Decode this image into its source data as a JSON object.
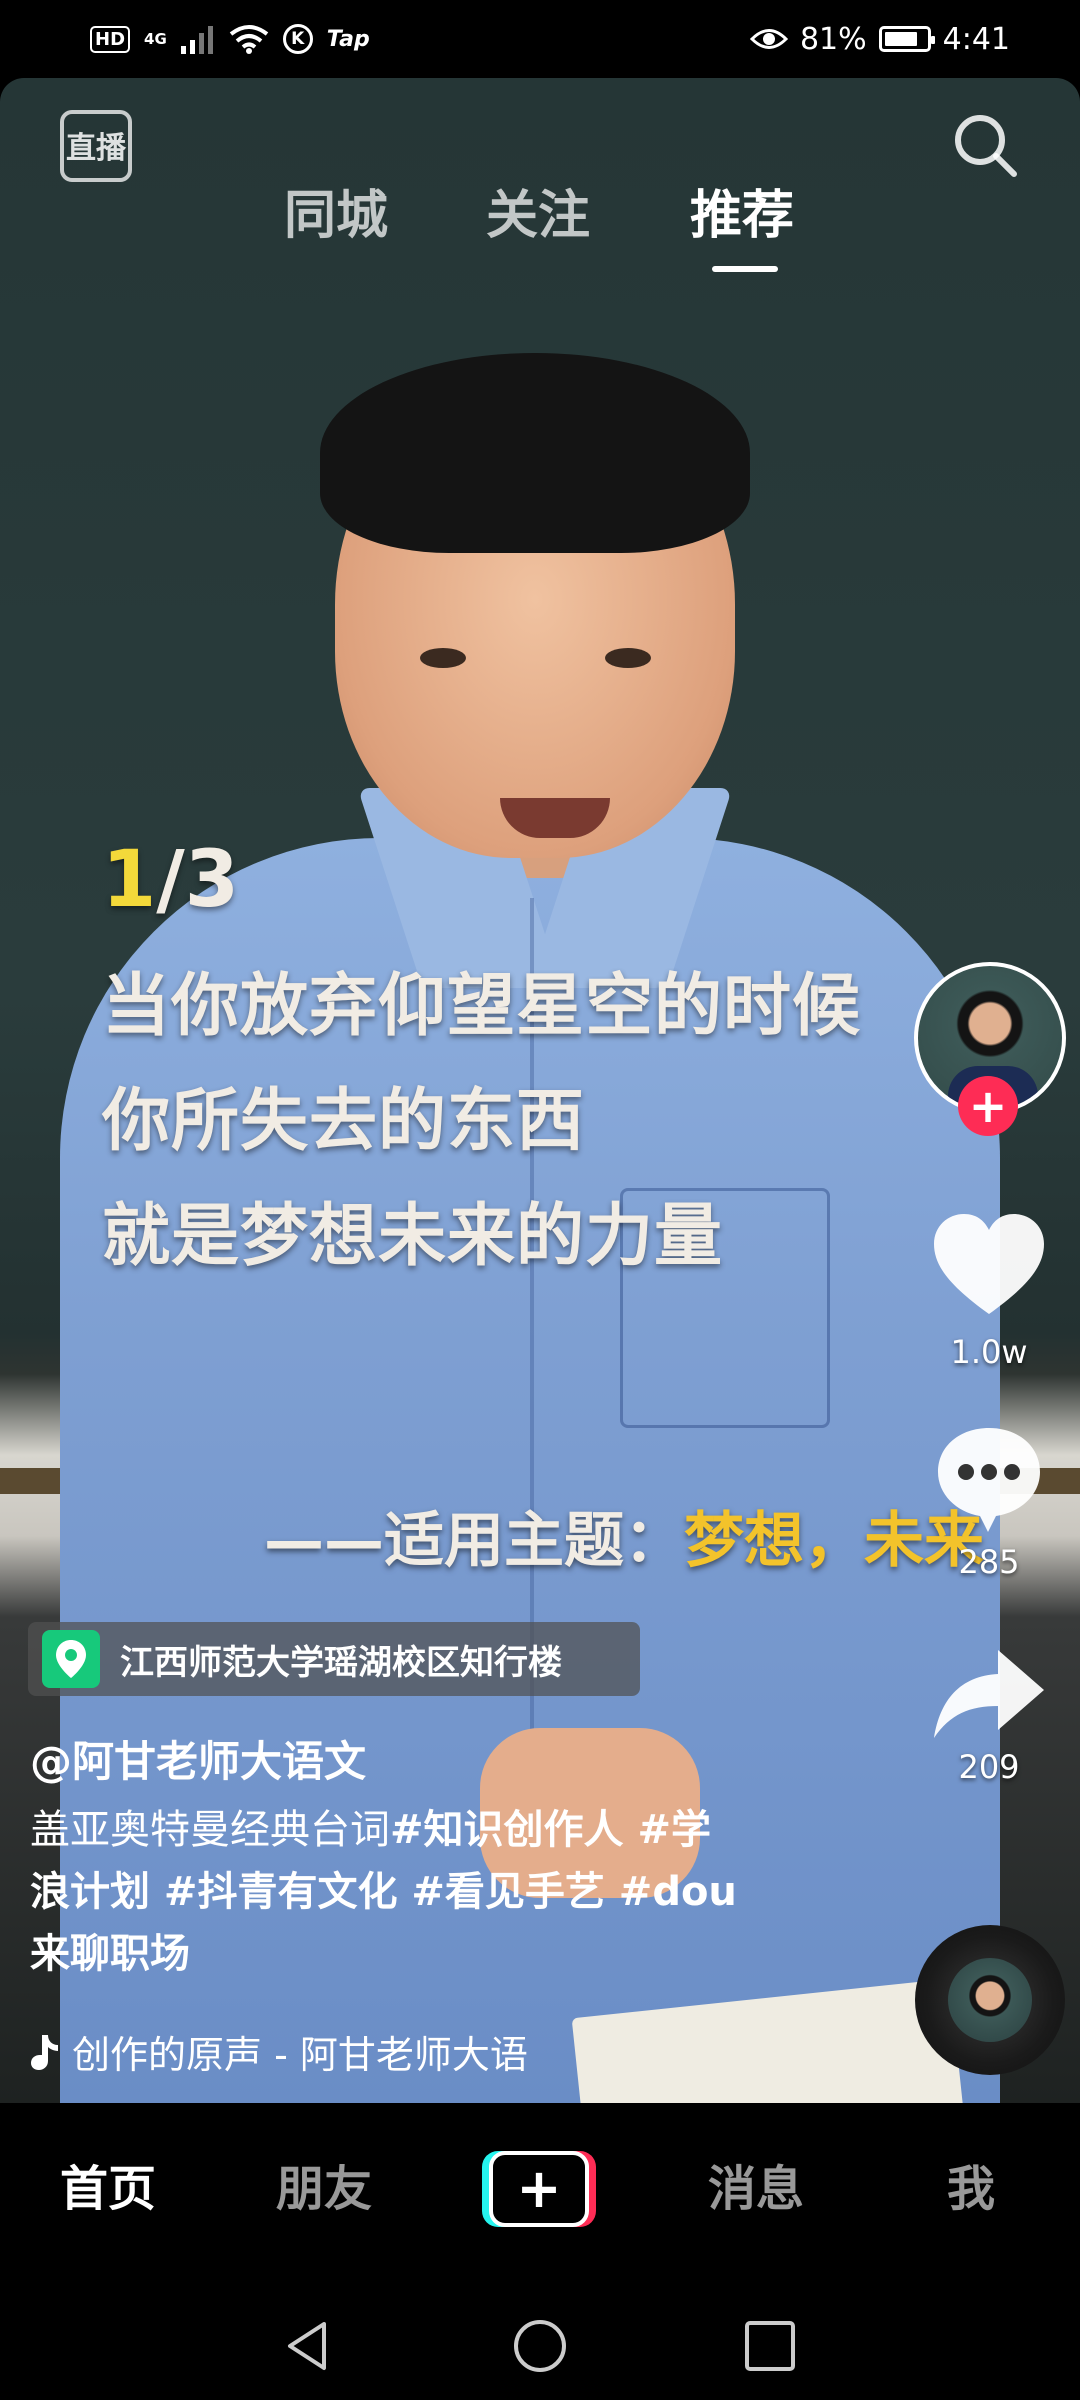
{
  "status_bar": {
    "hd": "HD",
    "network": "4G",
    "k_label": "K",
    "tap_label": "Tap",
    "battery_percent": "81%",
    "battery_level": 0.81,
    "time": "4:41"
  },
  "top_nav": {
    "live_label": "直播",
    "tabs": [
      {
        "label": "同城",
        "active": false
      },
      {
        "label": "关注",
        "active": false
      },
      {
        "label": "推荐",
        "active": true
      }
    ]
  },
  "video": {
    "counter_current": "1",
    "counter_total": "/3",
    "subtitle_lines": [
      "当你放弃仰望星空的时候",
      "你所失去的东西",
      "就是梦想未来的力量"
    ],
    "theme_prefix": "——适用主题：",
    "theme_value": "梦想，未来"
  },
  "right_rail": {
    "likes": "1.0w",
    "comments": "285",
    "shares": "209"
  },
  "info": {
    "location": "江西师范大学瑶湖校区知行楼",
    "author": "@阿甘老师大语文",
    "desc_line1_plain": "盖亚奥特曼经典台词",
    "desc_line1_bold": "#知识创作人 #学",
    "desc_line2": "浪计划 #抖青有文化 #看见手艺 #dou",
    "desc_line3": "来聊职场",
    "music": "创作的原声 - 阿甘老师大语"
  },
  "tab_bar": {
    "tabs": [
      "首页",
      "朋友",
      "消息",
      "我"
    ],
    "active": "首页",
    "create_symbol": "+"
  },
  "colors": {
    "brand_red": "#fe2c55",
    "brand_cyan": "#25f4ee",
    "location_green": "#17c97b",
    "subtitle_highlight": "#f3c32b"
  }
}
